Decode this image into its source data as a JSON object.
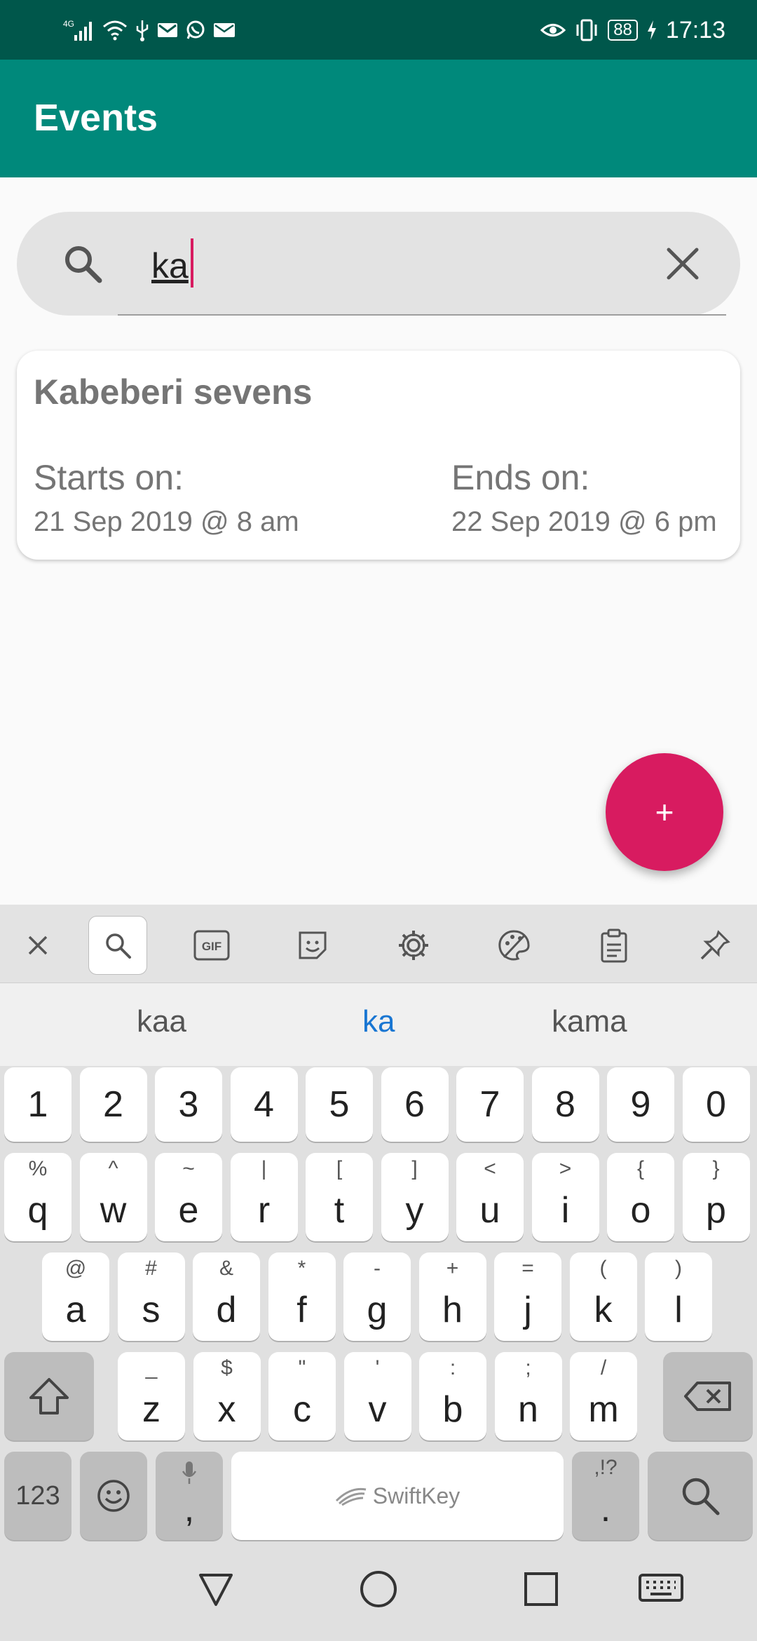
{
  "status_bar": {
    "network": "4G",
    "battery": "88",
    "time": "17:13"
  },
  "app_bar": {
    "title": "Events"
  },
  "search": {
    "value": "ka",
    "placeholder": ""
  },
  "event_card": {
    "title": "Kabeberi sevens",
    "starts_label": "Starts on:",
    "starts_value": "21 Sep 2019 @ 8 am",
    "ends_label": "Ends on:",
    "ends_value": "22 Sep 2019 @ 6 pm"
  },
  "fab": {
    "label": "+"
  },
  "keyboard": {
    "toolbar_icons": [
      "close-icon",
      "search-icon",
      "gif-icon",
      "sticker-icon",
      "settings-icon",
      "theme-icon",
      "clipboard-icon",
      "pin-icon"
    ],
    "gif_label": "GIF",
    "suggestions": [
      "kaa",
      "ka",
      "kama"
    ],
    "row_numbers": [
      "1",
      "2",
      "3",
      "4",
      "5",
      "6",
      "7",
      "8",
      "9",
      "0"
    ],
    "row1": [
      {
        "main": "q",
        "sup": "%"
      },
      {
        "main": "w",
        "sup": "^"
      },
      {
        "main": "e",
        "sup": "~"
      },
      {
        "main": "r",
        "sup": "|"
      },
      {
        "main": "t",
        "sup": "["
      },
      {
        "main": "y",
        "sup": "]"
      },
      {
        "main": "u",
        "sup": "<"
      },
      {
        "main": "i",
        "sup": ">"
      },
      {
        "main": "o",
        "sup": "{"
      },
      {
        "main": "p",
        "sup": "}"
      }
    ],
    "row2": [
      {
        "main": "a",
        "sup": "@"
      },
      {
        "main": "s",
        "sup": "#"
      },
      {
        "main": "d",
        "sup": "&"
      },
      {
        "main": "f",
        "sup": "*"
      },
      {
        "main": "g",
        "sup": "-"
      },
      {
        "main": "h",
        "sup": "+"
      },
      {
        "main": "j",
        "sup": "="
      },
      {
        "main": "k",
        "sup": "("
      },
      {
        "main": "l",
        "sup": ")"
      }
    ],
    "row3": [
      {
        "main": "z",
        "sup": "_"
      },
      {
        "main": "x",
        "sup": "$"
      },
      {
        "main": "c",
        "sup": "\""
      },
      {
        "main": "v",
        "sup": "'"
      },
      {
        "main": "b",
        "sup": ":"
      },
      {
        "main": "n",
        "sup": ";"
      },
      {
        "main": "m",
        "sup": "/"
      }
    ],
    "numbers_key": "123",
    "comma_key": ",",
    "space_brand": "SwiftKey",
    "period_key": ".",
    "period_sup": ",!?"
  },
  "colors": {
    "status_bar": "#00574b",
    "app_bar": "#00897b",
    "accent": "#d81b60",
    "suggestion_active": "#1976d2"
  }
}
